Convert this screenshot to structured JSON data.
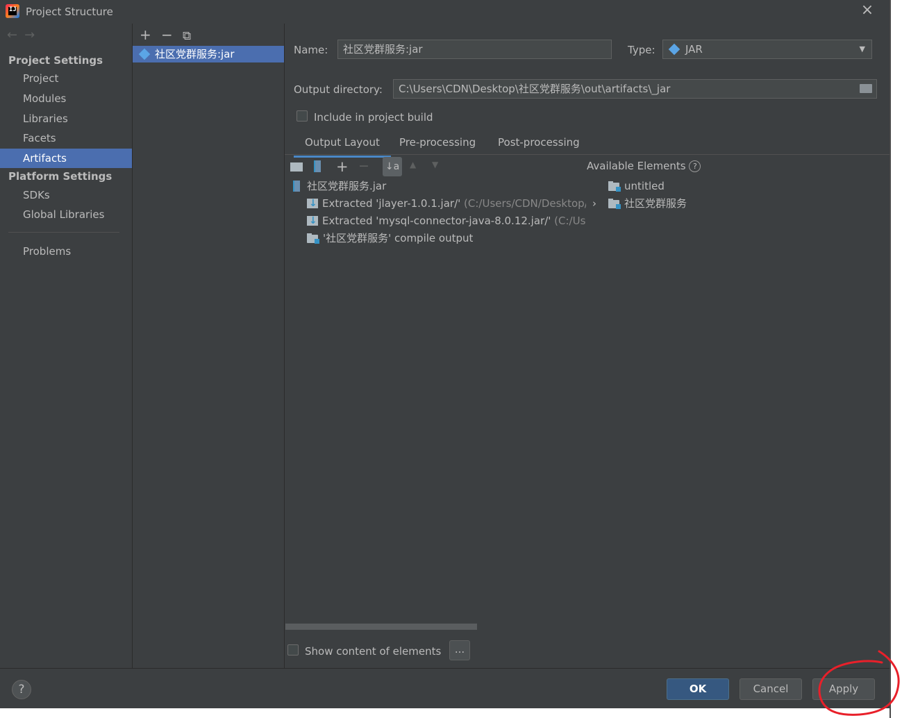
{
  "window": {
    "title": "Project Structure"
  },
  "sidebar": {
    "project_settings_header": "Project Settings",
    "project_items": [
      "Project",
      "Modules",
      "Libraries",
      "Facets",
      "Artifacts"
    ],
    "platform_settings_header": "Platform Settings",
    "platform_items": [
      "SDKs",
      "Global Libraries"
    ],
    "problems": "Problems",
    "selected": "Artifacts"
  },
  "artifacts_list": {
    "items": [
      "社区党群服务:jar"
    ]
  },
  "artifact": {
    "name_label": "Name:",
    "name_value": "社区党群服务:jar",
    "type_label": "Type:",
    "type_value": "JAR",
    "output_dir_label": "Output directory:",
    "output_dir_value": "C:\\Users\\CDN\\Desktop\\社区党群服务\\out\\artifacts\\_jar",
    "include_build_label": "Include in project build",
    "include_build_checked": false
  },
  "tabs": [
    {
      "label": "Output Layout",
      "active": true
    },
    {
      "label": "Pre-processing",
      "active": false
    },
    {
      "label": "Post-processing",
      "active": false
    }
  ],
  "layout_tree": {
    "root": "社区党群服务.jar",
    "children": [
      {
        "label": "Extracted 'jlayer-1.0.1.jar/'",
        "path": "(C:/Users/CDN/Desktop/社"
      },
      {
        "label": "Extracted 'mysql-connector-java-8.0.12.jar/'",
        "path": "(C:/User"
      },
      {
        "label": "'社区党群服务' compile output",
        "path": ""
      }
    ]
  },
  "available_elements": {
    "header": "Available Elements",
    "items": [
      "untitled",
      "社区党群服务"
    ]
  },
  "show_content_label": "Show content of elements",
  "more_button_label": "...",
  "buttons": {
    "ok": "OK",
    "cancel": "Cancel",
    "apply": "Apply",
    "help": "?"
  },
  "colors": {
    "background": "#3c3f41",
    "selection": "#4b6eaf",
    "default_button": "#365880",
    "annotation": "#e8202a"
  }
}
